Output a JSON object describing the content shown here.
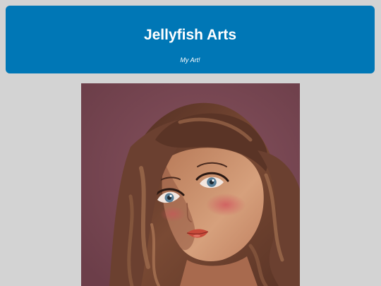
{
  "header": {
    "title": "Jellyfish Arts",
    "tagline": "My Art!"
  },
  "artwork": {
    "subject": "digital-portrait",
    "colors": {
      "background": "#7a4854",
      "hair": "#6b4030",
      "hair_highlight": "#9c6a4c",
      "skin": "#c98c68",
      "eyes": "#5a7f97",
      "lips": "#c84a3a"
    }
  },
  "colors": {
    "page_background": "#d3d3d3",
    "header_background": "#0077b6",
    "header_text": "#ffffff"
  }
}
